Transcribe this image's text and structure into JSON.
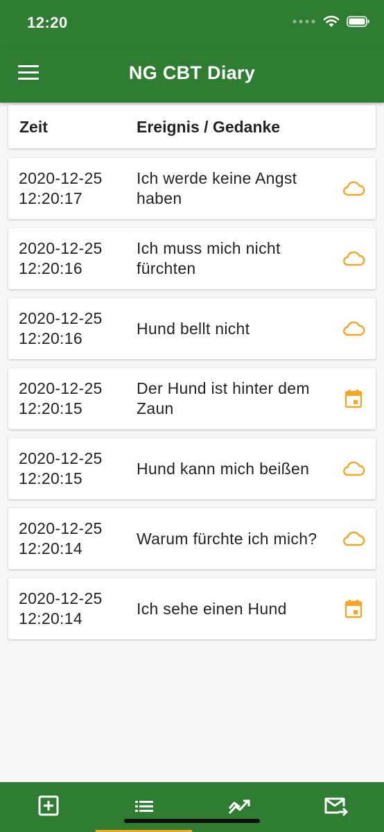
{
  "status": {
    "time": "12:20"
  },
  "appbar": {
    "title": "NG CBT Diary"
  },
  "table_header": {
    "time_label": "Zeit",
    "event_label": "Ereignis / Gedanke"
  },
  "entries": [
    {
      "date": "2020-12-25",
      "time": "12:20:17",
      "text": "Ich werde keine Angst haben",
      "icon": "cloud-icon"
    },
    {
      "date": "2020-12-25",
      "time": "12:20:16",
      "text": "Ich muss mich nicht fürchten",
      "icon": "cloud-icon"
    },
    {
      "date": "2020-12-25",
      "time": "12:20:16",
      "text": "Hund bellt nicht",
      "icon": "cloud-icon"
    },
    {
      "date": "2020-12-25",
      "time": "12:20:15",
      "text": "Der Hund ist hinter dem Zaun",
      "icon": "calendar-icon"
    },
    {
      "date": "2020-12-25",
      "time": "12:20:15",
      "text": "Hund kann mich beißen",
      "icon": "cloud-icon"
    },
    {
      "date": "2020-12-25",
      "time": "12:20:14",
      "text": "Warum fürchte ich mich?",
      "icon": "cloud-icon"
    },
    {
      "date": "2020-12-25",
      "time": "12:20:14",
      "text": "Ich sehe einen Hund",
      "icon": "calendar-icon"
    }
  ],
  "bottom_nav": [
    {
      "icon": "add-box-icon"
    },
    {
      "icon": "list-icon",
      "active": true
    },
    {
      "icon": "trending-icon"
    },
    {
      "icon": "forward-mail-icon"
    }
  ],
  "colors": {
    "primary": "#2e7d32",
    "accent": "#f9a825",
    "icon_orange": "#f5a623"
  }
}
